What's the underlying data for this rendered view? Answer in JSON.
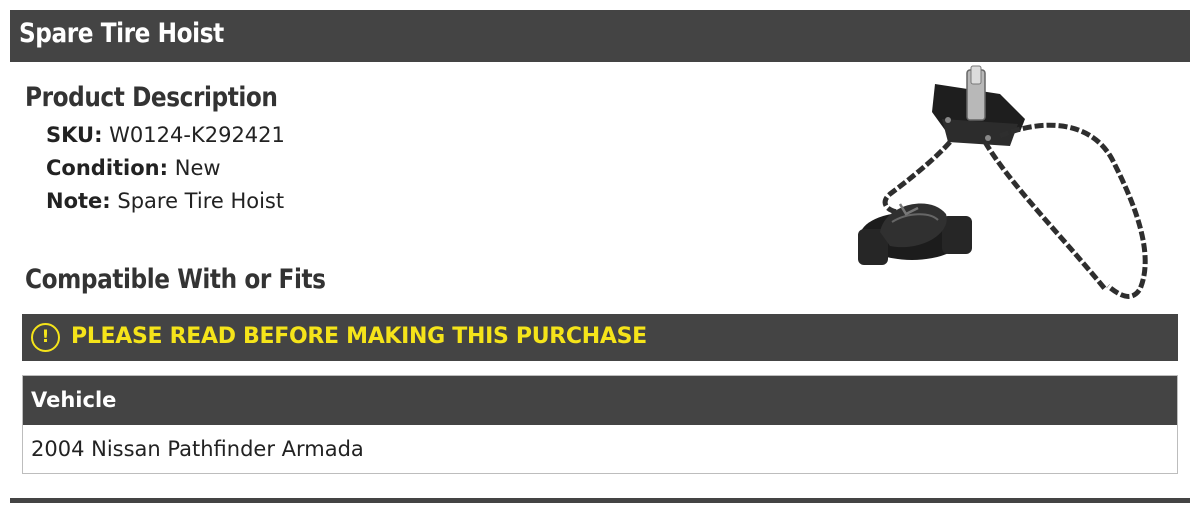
{
  "header": {
    "title": "Spare Tire Hoist"
  },
  "description": {
    "heading": "Product Description",
    "specs": {
      "sku_label": "SKU:",
      "sku_value": "W0124-K292421",
      "condition_label": "Condition:",
      "condition_value": "New",
      "note_label": "Note:",
      "note_value": "Spare Tire Hoist"
    }
  },
  "compatibility": {
    "heading": "Compatible With or Fits",
    "warning": {
      "icon": "exclamation-circle-icon",
      "text": "PLEASE READ BEFORE MAKING THIS PURCHASE"
    },
    "table": {
      "columns": [
        "Vehicle"
      ],
      "rows": [
        [
          "2004 Nissan Pathfinder Armada"
        ]
      ]
    }
  },
  "product_image": {
    "subject": "spare-tire-hoist"
  },
  "colors": {
    "bar_bg": "#444444",
    "warning_text": "#f5e41a",
    "text": "#222222"
  }
}
